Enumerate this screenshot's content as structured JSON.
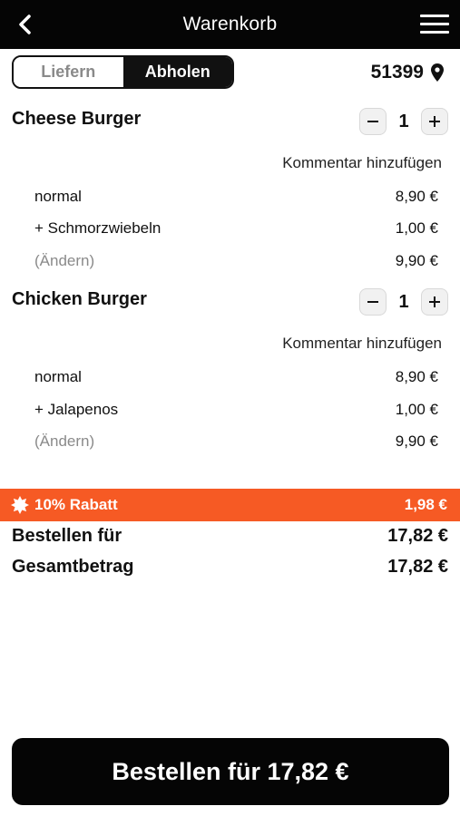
{
  "header": {
    "title": "Warenkorb",
    "back_icon": "chevron-left-icon",
    "menu_icon": "hamburger-menu-icon"
  },
  "mode_toggle": {
    "options": [
      "Liefern",
      "Abholen"
    ],
    "selected": "Abholen"
  },
  "location": {
    "zip": "51399",
    "icon": "map-pin-icon"
  },
  "cart_items": [
    {
      "name": "Cheese Burger",
      "quantity": "1",
      "comment_link": "Kommentar hinzufügen",
      "lines": [
        {
          "label": "normal",
          "value": "8,90 €"
        },
        {
          "label": "+ Schmorzwiebeln",
          "value": "1,00 €"
        },
        {
          "label": "(Ändern)",
          "value": "9,90 €"
        }
      ]
    },
    {
      "name": "Chicken Burger",
      "quantity": "1",
      "comment_link": "Kommentar hinzufügen",
      "lines": [
        {
          "label": "normal",
          "value": "8,90 €"
        },
        {
          "label": "+ Jalapenos",
          "value": "1,00 €"
        },
        {
          "label": "(Ändern)",
          "value": "9,90 €"
        }
      ]
    }
  ],
  "discount": {
    "label": "10% Rabatt",
    "value": "1,98 €",
    "icon": "badge-star-icon"
  },
  "totals": {
    "order_for_label": "Bestellen für",
    "order_for_value": "17,82 €",
    "total_label": "Gesamtbetrag",
    "total_value": "17,82 €"
  },
  "checkout_button": {
    "label": "Bestellen für 17,82 €"
  },
  "colors": {
    "header_bg": "#050505",
    "discount_bg": "#f65a24",
    "muted_text": "#8a8a8a"
  }
}
